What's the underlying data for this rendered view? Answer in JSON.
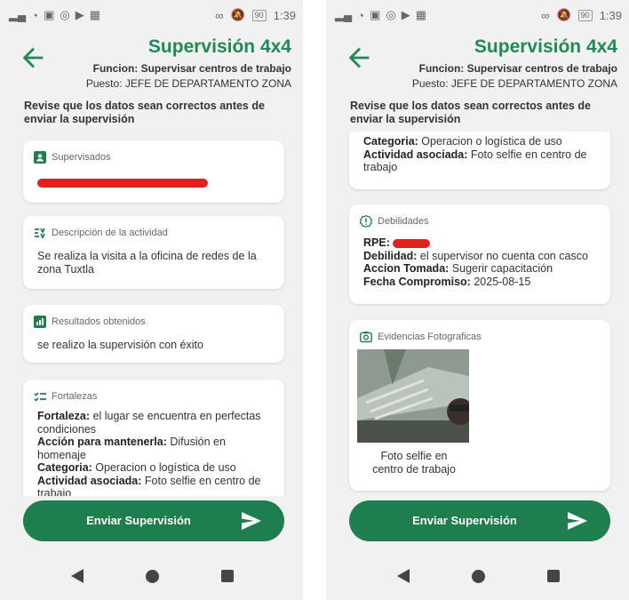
{
  "status": {
    "time": "1:39",
    "battery": "90"
  },
  "app": {
    "title": "Supervisión 4x4",
    "funcion": "Funcion: Supervisar centros de trabajo",
    "puesto": "Puesto: JEFE DE DEPARTAMENTO ZONA",
    "instruction": "Revise que los datos sean correctos antes de enviar la supervisión"
  },
  "left": {
    "supervisados": {
      "label": "Supervisados"
    },
    "descripcion": {
      "label": "Descripción de la actividad",
      "text": "Se realiza la visita a la oficina de redes de la zona Tuxtla"
    },
    "resultados": {
      "label": "Resultados obtenidos",
      "text": "se realizo la supervisión con éxito"
    },
    "fortalezas": {
      "label": "Fortalezas",
      "fortaleza_k": "Fortaleza:",
      "fortaleza_v": " el lugar se encuentra en perfectas condiciones",
      "accion_k": "Acción para mantenerla:",
      "accion_v": " Difusión en homenaje",
      "categoria_k": "Categoria:",
      "categoria_v": " Operacion o logística de uso",
      "actividad_k": "Actividad asociada:",
      "actividad_v": " Foto selfie en centro de trabajo"
    }
  },
  "right": {
    "categoria_k": "Categoria:",
    "categoria_v": " Operacion o logística de uso",
    "actividad_k": "Actividad asociada:",
    "actividad_v": " Foto selfie en centro de trabajo",
    "debilidades": {
      "label": "Debilidades",
      "rpe_k": "RPE:",
      "debilidad_k": "Debilidad:",
      "debilidad_v": " el supervisor no cuenta con casco",
      "accion_k": "Accion Tomada:",
      "accion_v": " Sugerir capacitación",
      "fecha_k": "Fecha Compromiso:",
      "fecha_v": " 2025-08-15"
    },
    "evidencias": {
      "label": "Evidencias Fotograficas",
      "caption": "Foto selfie en centro de trabajo"
    }
  },
  "button": {
    "label": "Enviar Supervisión"
  },
  "colors": {
    "primary": "#1e8a55",
    "button": "#1e7e4e",
    "redaction": "#e0201f"
  }
}
